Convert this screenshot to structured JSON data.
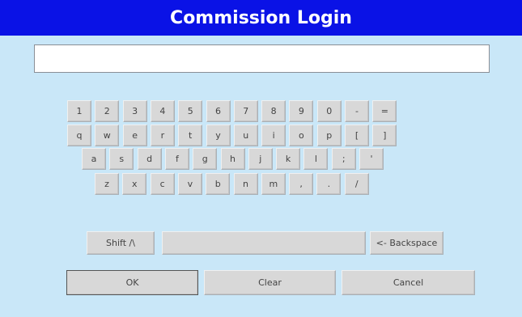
{
  "title": "Commission Login",
  "input": {
    "value": ""
  },
  "keyboard": {
    "row1": [
      "1",
      "2",
      "3",
      "4",
      "5",
      "6",
      "7",
      "8",
      "9",
      "0",
      "-",
      "="
    ],
    "row2": [
      "q",
      "w",
      "e",
      "r",
      "t",
      "y",
      "u",
      "i",
      "o",
      "p",
      "[",
      "]"
    ],
    "row3": [
      "a",
      "s",
      "d",
      "f",
      "g",
      "h",
      "j",
      "k",
      "l",
      ";",
      "'"
    ],
    "row4": [
      "z",
      "x",
      "c",
      "v",
      "b",
      "n",
      "m",
      ",",
      ".",
      "/"
    ],
    "shift_label": "Shift /\\",
    "space_label": "",
    "backspace_label": "<- Backspace"
  },
  "actions": {
    "ok_label": "OK",
    "clear_label": "Clear",
    "cancel_label": "Cancel"
  },
  "colors": {
    "title_bar": "#0a12e6",
    "background": "#c9e7f8",
    "key_face": "#d8d8d8"
  }
}
